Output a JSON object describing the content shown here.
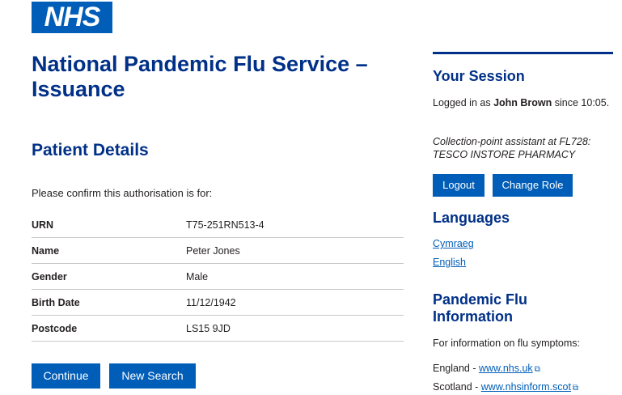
{
  "logo": {
    "text": "NHS"
  },
  "page": {
    "title": "National Pandemic Flu Service – Issuance",
    "section_title": "Patient Details",
    "intro": "Please confirm this authorisation is for:"
  },
  "patient": [
    {
      "label": "URN",
      "value": "T75-251RN513-4"
    },
    {
      "label": "Name",
      "value": "Peter Jones"
    },
    {
      "label": "Gender",
      "value": "Male"
    },
    {
      "label": "Birth Date",
      "value": "11/12/1942"
    },
    {
      "label": "Postcode",
      "value": "LS15 9JD"
    }
  ],
  "actions": {
    "continue_label": "Continue",
    "new_search_label": "New Search"
  },
  "session": {
    "title": "Your Session",
    "logged_in_prefix": "Logged in as",
    "user": "John Brown",
    "since_text": "since 10:05.",
    "role_line1": "Collection-point assistant at FL728:",
    "role_line2": "TESCO INSTORE PHARMACY",
    "logout_label": "Logout",
    "change_role_label": "Change Role"
  },
  "languages": {
    "title": "Languages",
    "items": [
      "Cymraeg",
      "English"
    ]
  },
  "flu_info": {
    "title_line1": "Pandemic Flu",
    "title_line2": "Information",
    "intro": "For information on flu symptoms:",
    "links": [
      {
        "region": "England - ",
        "url_text": "www.nhs.uk"
      },
      {
        "region": "Scotland - ",
        "url_text": "www.nhsinform.scot"
      }
    ]
  },
  "colors": {
    "nhs_blue": "#005eb8",
    "dark_blue": "#003087"
  }
}
